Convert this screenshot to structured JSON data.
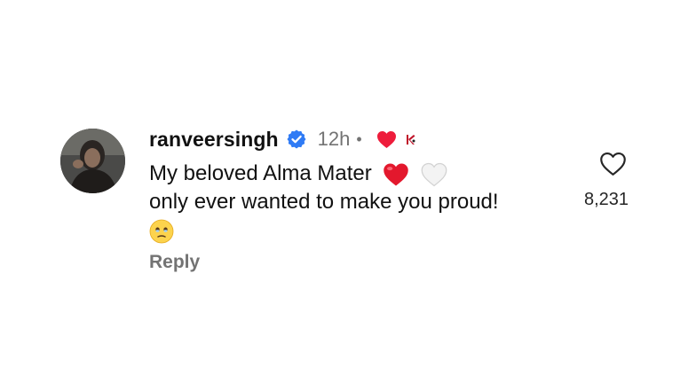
{
  "comment": {
    "avatar_icon": "user-avatar-photo",
    "username": "ranveersingh",
    "verified_icon": "verified-badge-icon",
    "time": "12h",
    "separator": "•",
    "creator_liked_icon": "red-heart-icon",
    "creator_avatar_icon": "creator-mini-avatar",
    "text_line1": "My beloved Alma Mater",
    "text_line2": "only ever wanted to make you proud!",
    "emojis": [
      "red-heart-emoji",
      "white-heart-emoji",
      "face-holding-back-tears-emoji"
    ],
    "reply_label": "Reply",
    "like_icon": "heart-outline-icon",
    "like_count": "8,231"
  },
  "colors": {
    "verified_blue": "#2f7bf5",
    "liked_red": "#ee1c3b",
    "muted_gray": "#737373",
    "text": "#111111"
  }
}
